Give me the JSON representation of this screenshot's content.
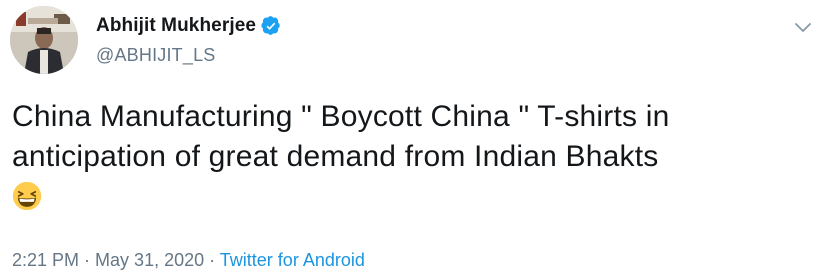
{
  "author": {
    "display_name": "Abhijit Mukherjee",
    "handle": "@ABHIJIT_LS",
    "verified": true
  },
  "tweet": {
    "text_line1": "China Manufacturing \" Boycott China \" T-shirts in",
    "text_line2": "anticipation of great demand from Indian Bhakts",
    "emoji": "grinning-squinting-face"
  },
  "meta": {
    "time": "2:21 PM",
    "sep1": " · ",
    "date": "May 31, 2020",
    "sep2": " · ",
    "source": "Twitter for Android"
  },
  "icons": [
    "verified-badge-icon",
    "chevron-down-icon",
    "grinning-squinting-face-emoji"
  ],
  "colors": {
    "text": "#14171a",
    "secondary": "#657786",
    "link": "#1b95e0",
    "verified": "#1da1f2"
  }
}
